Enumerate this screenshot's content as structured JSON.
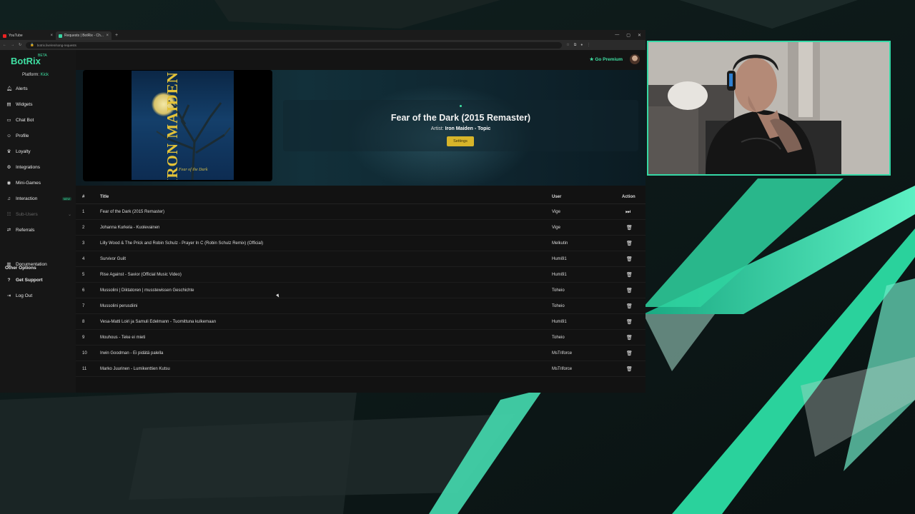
{
  "browser": {
    "tabs": [
      {
        "label": "YouTube"
      },
      {
        "label": "Requests | BotRix - Ch..."
      }
    ],
    "new_tab": "+",
    "address": "botrix.live/en/song-requests",
    "window_controls": [
      "—",
      "▢",
      "✕"
    ]
  },
  "app": {
    "logo": "BotRix",
    "beta": "BETA",
    "platform_label": "Platform:",
    "platform_value": "Kick",
    "go_premium": "★ Go Premium",
    "nav": [
      {
        "label": "Alerts",
        "icon": "bell-icon"
      },
      {
        "label": "Widgets",
        "icon": "layers-icon"
      },
      {
        "label": "Chat Bot",
        "icon": "chat-icon"
      },
      {
        "label": "Profile",
        "icon": "user-icon"
      },
      {
        "label": "Loyalty",
        "icon": "trophy-icon"
      },
      {
        "label": "Integrations",
        "icon": "plug-icon"
      },
      {
        "label": "Mini-Games",
        "icon": "gamepad-icon"
      },
      {
        "label": "Interaction",
        "icon": "music-icon",
        "badge": "NEW"
      },
      {
        "label": "Sub-Users",
        "icon": "users-icon"
      },
      {
        "label": "Referrals",
        "icon": "share-icon"
      }
    ],
    "other_options_title": "Other Options",
    "other_nav": [
      {
        "label": "Documentation",
        "icon": "book-icon"
      },
      {
        "label": "Get Support",
        "icon": "help-icon"
      },
      {
        "label": "Log Out",
        "icon": "logout-icon"
      }
    ]
  },
  "now_playing": {
    "title": "Fear of the Dark (2015 Remaster)",
    "artist_label": "Artist:",
    "artist": "Iron Maiden - Topic",
    "settings_button": "Settings",
    "cover_band": "IRON MAIDEN",
    "cover_album": "Fear of the Dark"
  },
  "queue": {
    "headers": {
      "num": "#",
      "title": "Title",
      "user": "User",
      "action": "Action"
    },
    "rows": [
      {
        "num": "1",
        "title": "Fear of the Dark (2015 Remaster)",
        "user": "Vige",
        "action": "skip"
      },
      {
        "num": "2",
        "title": "Johanna Kurkela - Kuolevainen",
        "user": "Vige",
        "action": "delete"
      },
      {
        "num": "3",
        "title": "Lilly Wood & The Prick and Robin Schulz - Prayer In C (Robin Schulz Remix) (Official)",
        "user": "Melkutin",
        "action": "delete"
      },
      {
        "num": "4",
        "title": "Survivor Guilt",
        "user": "Humi91",
        "action": "delete"
      },
      {
        "num": "5",
        "title": "Rise Against - Savior (Official Music Video)",
        "user": "Humi91",
        "action": "delete"
      },
      {
        "num": "6",
        "title": "Mussolini | Diktatoren | musstewissen Geschichte",
        "user": "Toheio",
        "action": "delete"
      },
      {
        "num": "7",
        "title": "Mussolini perusdiini",
        "user": "Toheio",
        "action": "delete"
      },
      {
        "num": "8",
        "title": "Vesa-Matti Loiri ja Samuli Edelmann - Tuomittuna kulkemaan",
        "user": "Humi91",
        "action": "delete"
      },
      {
        "num": "9",
        "title": "Mouhous - Teke ei mieti",
        "user": "Toheio",
        "action": "delete"
      },
      {
        "num": "10",
        "title": "Irwin Goodman - Ei pidätä palella",
        "user": "MsTriforce",
        "action": "delete"
      },
      {
        "num": "11",
        "title": "Marko Juurinen - Lumikenttien Kutsu",
        "user": "MsTriforce",
        "action": "delete"
      }
    ]
  },
  "colors": {
    "accent": "#3fe0a3",
    "settings_button": "#d7b52a",
    "webcam_border": "#35d8a6"
  }
}
